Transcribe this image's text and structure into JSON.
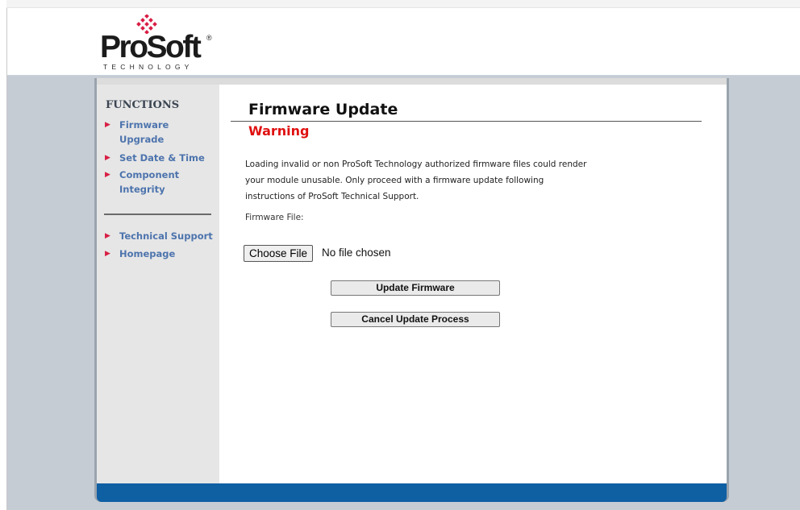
{
  "logo": {
    "name": "ProSoft",
    "registered": "®",
    "tagline": "TECHNOLOGY"
  },
  "sidebar": {
    "title": "FUNCTIONS",
    "items": [
      {
        "label": "Firmware Upgrade",
        "icon": "triangle-right-icon"
      },
      {
        "label": "Set Date & Time",
        "icon": "triangle-right-icon"
      },
      {
        "label": "Component Integrity",
        "icon": "triangle-right-icon"
      },
      {
        "label": "Technical Support",
        "icon": "triangle-right-icon"
      },
      {
        "label": "Homepage",
        "icon": "triangle-right-icon"
      }
    ]
  },
  "main": {
    "title": "Firmware Update",
    "warning_title": "Warning",
    "warning_text": "Loading invalid or non ProSoft Technology authorized firmware files could render your module unusable. Only proceed with a firmware update following instructions of ProSoft Technical Support.",
    "file_label": "Firmware File:",
    "choose_file_label": "Choose File",
    "no_file_text": "No file chosen",
    "update_button": "Update Firmware",
    "cancel_button": "Cancel Update Process"
  },
  "colors": {
    "nav_link": "#4d74ad",
    "nav_arrow": "#d81e44",
    "warning": "#e01010",
    "footer_bar": "#0f5fa3",
    "page_background": "#c6ccd3",
    "logo_mark": "#d81e44"
  }
}
